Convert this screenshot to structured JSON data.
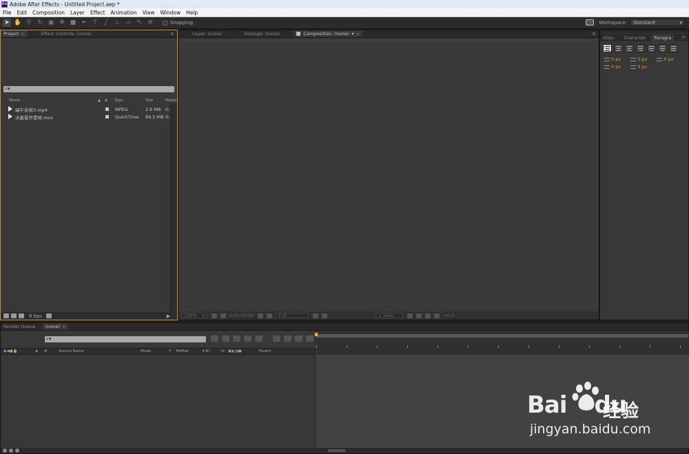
{
  "window": {
    "title": "Adobe After Effects - Untitled Project.aep *",
    "logo": "Ae"
  },
  "menu": [
    "File",
    "Edit",
    "Composition",
    "Layer",
    "Effect",
    "Animation",
    "View",
    "Window",
    "Help"
  ],
  "toolbar": {
    "tools": [
      "selection-tool-icon",
      "hand-tool-icon",
      "zoom-tool-icon",
      "rotation-tool-icon",
      "camera-tool-icon",
      "pan-behind-tool-icon",
      "rectangle-tool-icon",
      "pen-tool-icon",
      "type-tool-icon",
      "brush-tool-icon",
      "clone-stamp-tool-icon",
      "eraser-tool-icon",
      "roto-brush-tool-icon",
      "puppet-tool-icon"
    ],
    "snapping_label": "Snapping",
    "workspace_label": "Workspace:",
    "workspace_value": "Standard"
  },
  "project_panel": {
    "tabs": [
      "Project",
      "Effect Controls: (none)"
    ],
    "search_glyph": "⌕▾",
    "columns": {
      "name": "Name",
      "type": "Type",
      "size": "Size",
      "media": "Media"
    },
    "items": [
      {
        "name": "端午央视3.mp4",
        "type": "MPEG",
        "size": "2.6 MB",
        "media": "0:"
      },
      {
        "name": "水墨晕开素材.mov",
        "type": "QuickTime",
        "size": "89.5 MB",
        "media": "0:"
      }
    ],
    "bpc_label": "8 bpc"
  },
  "viewer": {
    "tabs": [
      "Layer: (none)",
      "Footage: (none)",
      "Composition: (none)"
    ],
    "footer": {
      "magnification": "100%",
      "timecode": "0;00;00;00",
      "resolution": "Full",
      "views": "1 View",
      "exposure": "+0.0"
    }
  },
  "right_panel": {
    "tabs": [
      "Align",
      "Character",
      "Paragra"
    ],
    "indent_values": [
      "0 px",
      "0 px",
      "0 px",
      "0 px",
      "0 px"
    ]
  },
  "timeline": {
    "tabs": [
      "Render Queue",
      "(none)"
    ],
    "search_glyph": "⌕▾",
    "columns": {
      "num": "#",
      "source": "Source Name",
      "mode": "Mode",
      "t": "T",
      "trkmat": "TrkMat",
      "switches": "fx",
      "parent": "Parent"
    }
  },
  "watermark": {
    "brand": "Bai",
    "brand_suffix": "du",
    "cn": "经验",
    "url": "jingyan.baidu.com"
  }
}
